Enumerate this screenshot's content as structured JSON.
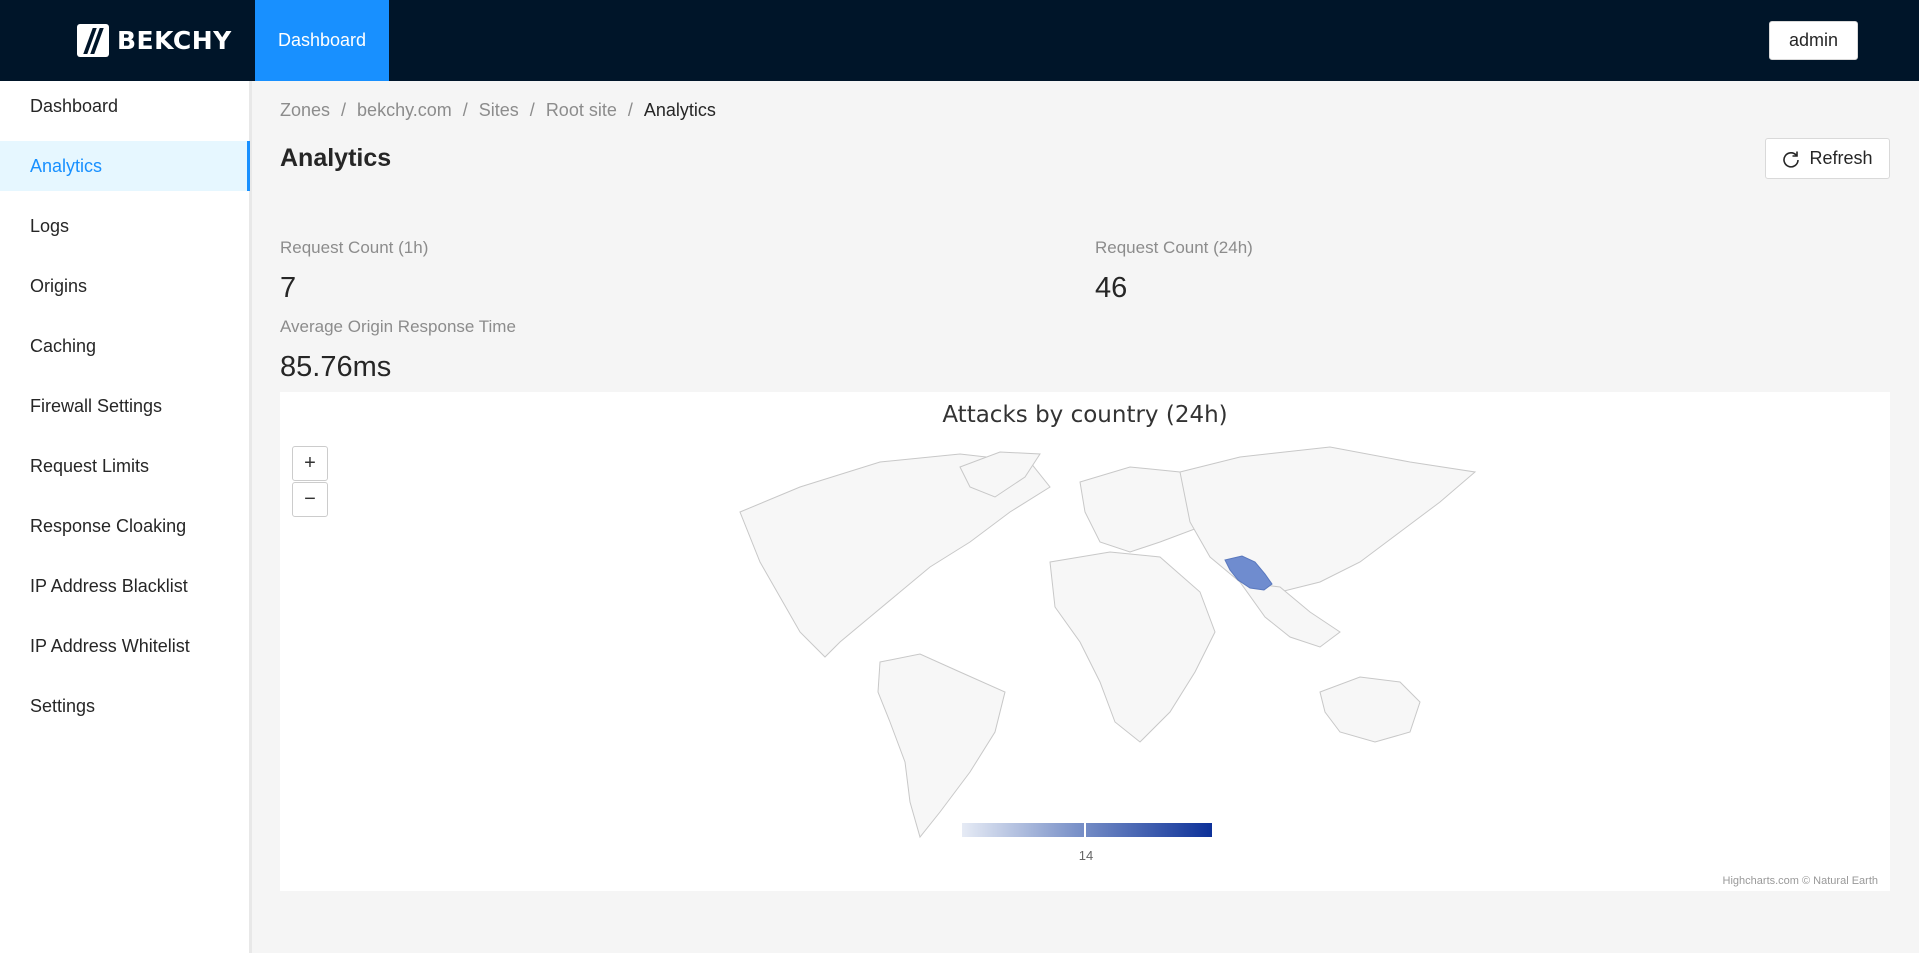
{
  "header": {
    "brand": "BEKCHY",
    "active_tab": "Dashboard",
    "user_button": "admin"
  },
  "sidebar": {
    "items": [
      {
        "label": "Dashboard"
      },
      {
        "label": "Analytics"
      },
      {
        "label": "Logs"
      },
      {
        "label": "Origins"
      },
      {
        "label": "Caching"
      },
      {
        "label": "Firewall Settings"
      },
      {
        "label": "Request Limits"
      },
      {
        "label": "Response Cloaking"
      },
      {
        "label": "IP Address Blacklist"
      },
      {
        "label": "IP Address Whitelist"
      },
      {
        "label": "Settings"
      }
    ],
    "active_item": "Analytics"
  },
  "breadcrumb": [
    "Zones",
    "bekchy.com",
    "Sites",
    "Root site",
    "Analytics"
  ],
  "page": {
    "title": "Analytics",
    "refresh_label": "Refresh"
  },
  "stats": {
    "request_count_1h": {
      "label": "Request Count (1h)",
      "value": "7"
    },
    "request_count_24h": {
      "label": "Request Count (24h)",
      "value": "46"
    },
    "avg_origin_response": {
      "label": "Average Origin Response Time",
      "value": "85.76ms"
    }
  },
  "chart_data": {
    "type": "map",
    "title": "Attacks by country (24h)",
    "series": [
      {
        "country": "Iran",
        "value": 14
      }
    ],
    "color_axis": {
      "min_color": "#e6ebf5",
      "max_color": "#0d3199",
      "labels": [
        "14"
      ]
    },
    "zoom_controls": [
      "+",
      "−"
    ],
    "credits": "Highcharts.com © Natural Earth"
  },
  "colors": {
    "header_bg": "#001529",
    "accent": "#1890ff",
    "highlight_country": "#6f8ccf"
  }
}
